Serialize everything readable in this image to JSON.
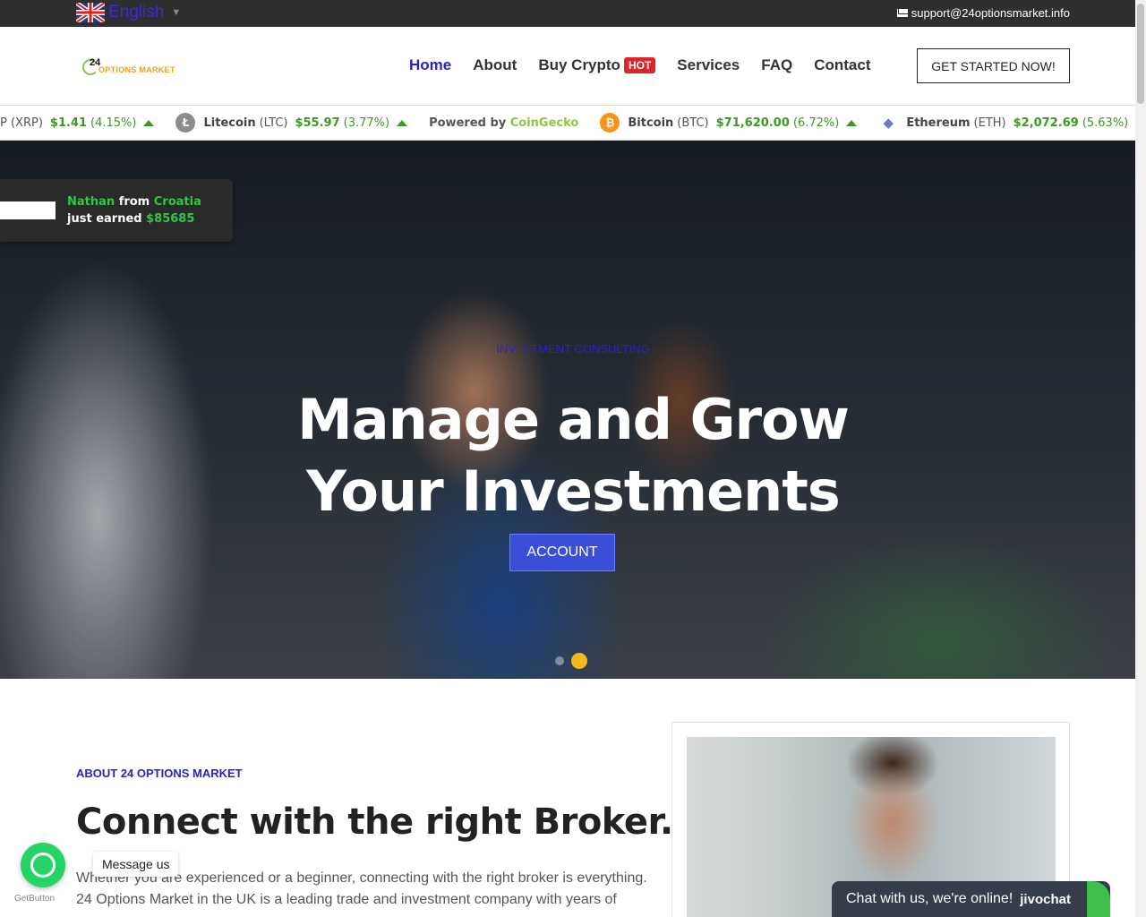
{
  "topbar": {
    "language": "English",
    "email": "support@24optionsmarket.info"
  },
  "header": {
    "logo_number": "24",
    "logo_text": "OPTIONS MARKET",
    "nav": [
      {
        "label": "Home"
      },
      {
        "label": "About"
      },
      {
        "label": "Buy Crypto",
        "badge": "HOT"
      },
      {
        "label": "Services"
      },
      {
        "label": "FAQ"
      },
      {
        "label": "Contact"
      }
    ],
    "cta": "GET STARTED NOW!"
  },
  "ticker": {
    "items": [
      {
        "name": "",
        "symbol": "P (XRP)",
        "price": "$1.41",
        "change": "(4.15%)",
        "color": "#333333",
        "glyph": ""
      },
      {
        "name": "Litecoin",
        "symbol": "(LTC)",
        "price": "$55.97",
        "change": "(3.77%)",
        "color": "#8c8c8c",
        "glyph": "Ł"
      },
      {
        "name": "Bitcoin",
        "symbol": "(BTC)",
        "price": "$71,620.00",
        "change": "(6.72%)",
        "color": "#f7931a",
        "glyph": "₿"
      },
      {
        "name": "Ethereum",
        "symbol": "(ETH)",
        "price": "$2,072.69",
        "change": "(5.63%)",
        "color": "#6b7bd1",
        "glyph": "◆"
      }
    ],
    "powered_prefix": "Powered by",
    "powered_brand": "CoinGecko"
  },
  "toast": {
    "name": "Nathan",
    "from": "from",
    "country": "Croatia",
    "earned": "just earned",
    "amount": "$85685"
  },
  "hero": {
    "eyebrow": "INVESTMENT CONSULTING",
    "title_line1": "Manage and Grow",
    "title_line2": "Your Investments",
    "button": "ACCOUNT"
  },
  "about": {
    "eyebrow": "ABOUT 24 OPTIONS MARKET",
    "title": "Connect with the right Broker.",
    "paragraph": "Whether you are experienced or a beginner, connecting with the right broker is everything. 24 Options Market in the UK is a leading trade and investment company with years of"
  },
  "widgets": {
    "whatsapp_label": "Message us",
    "getbutton": "GetButton",
    "chat_text": "Chat with us, we're online!",
    "chat_brand": "jivochat"
  },
  "colors": {
    "accent": "#2b22c8",
    "hot": "#e0242c",
    "up": "#3a9a1f",
    "highlight": "#34c34a"
  }
}
